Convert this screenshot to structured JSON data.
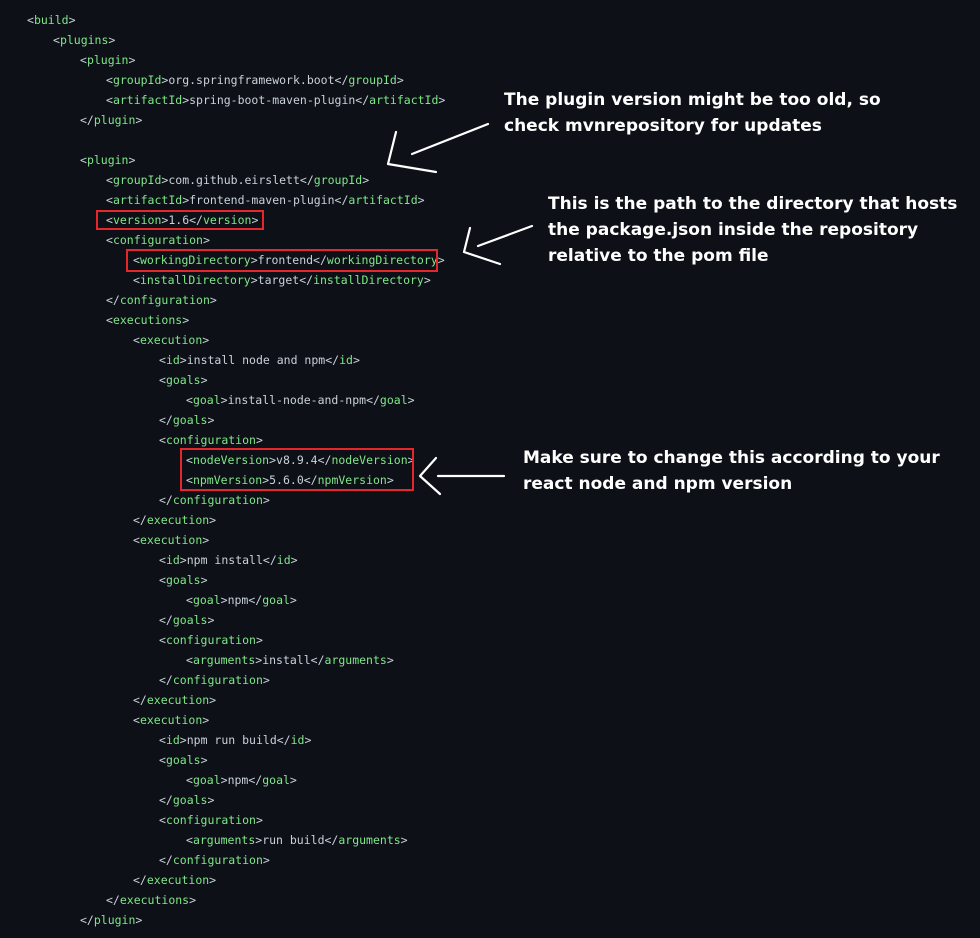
{
  "code_lines": [
    {
      "indent": 1,
      "tag": "build",
      "close": false
    },
    {
      "indent": 2,
      "tag": "plugins",
      "close": false
    },
    {
      "indent": 3,
      "tag": "plugin",
      "close": false
    },
    {
      "indent": 4,
      "tag": "groupId",
      "value": "org.springframework.boot"
    },
    {
      "indent": 4,
      "tag": "artifactId",
      "value": "spring-boot-maven-plugin"
    },
    {
      "indent": 3,
      "tag": "plugin",
      "close": true
    },
    {
      "blank": true
    },
    {
      "indent": 3,
      "tag": "plugin",
      "close": false
    },
    {
      "indent": 4,
      "tag": "groupId",
      "value": "com.github.eirslett"
    },
    {
      "indent": 4,
      "tag": "artifactId",
      "value": "frontend-maven-plugin"
    },
    {
      "indent": 4,
      "tag": "version",
      "value": "1.6"
    },
    {
      "indent": 4,
      "tag": "configuration",
      "close": false
    },
    {
      "indent": 5,
      "tag": "workingDirectory",
      "value": "frontend"
    },
    {
      "indent": 5,
      "tag": "installDirectory",
      "value": "target"
    },
    {
      "indent": 4,
      "tag": "configuration",
      "close": true
    },
    {
      "indent": 4,
      "tag": "executions",
      "close": false
    },
    {
      "indent": 5,
      "tag": "execution",
      "close": false
    },
    {
      "indent": 6,
      "tag": "id",
      "value": "install node and npm"
    },
    {
      "indent": 6,
      "tag": "goals",
      "close": false
    },
    {
      "indent": 7,
      "tag": "goal",
      "value": "install-node-and-npm"
    },
    {
      "indent": 6,
      "tag": "goals",
      "close": true
    },
    {
      "indent": 6,
      "tag": "configuration",
      "close": false
    },
    {
      "indent": 7,
      "tag": "nodeVersion",
      "value": "v8.9.4"
    },
    {
      "indent": 7,
      "tag": "npmVersion",
      "value": "5.6.0"
    },
    {
      "indent": 6,
      "tag": "configuration",
      "close": true
    },
    {
      "indent": 5,
      "tag": "execution",
      "close": true
    },
    {
      "indent": 5,
      "tag": "execution",
      "close": false
    },
    {
      "indent": 6,
      "tag": "id",
      "value": "npm install"
    },
    {
      "indent": 6,
      "tag": "goals",
      "close": false
    },
    {
      "indent": 7,
      "tag": "goal",
      "value": "npm"
    },
    {
      "indent": 6,
      "tag": "goals",
      "close": true
    },
    {
      "indent": 6,
      "tag": "configuration",
      "close": false
    },
    {
      "indent": 7,
      "tag": "arguments",
      "value": "install"
    },
    {
      "indent": 6,
      "tag": "configuration",
      "close": true
    },
    {
      "indent": 5,
      "tag": "execution",
      "close": true
    },
    {
      "indent": 5,
      "tag": "execution",
      "close": false
    },
    {
      "indent": 6,
      "tag": "id",
      "value": "npm run build"
    },
    {
      "indent": 6,
      "tag": "goals",
      "close": false
    },
    {
      "indent": 7,
      "tag": "goal",
      "value": "npm"
    },
    {
      "indent": 6,
      "tag": "goals",
      "close": true
    },
    {
      "indent": 6,
      "tag": "configuration",
      "close": false
    },
    {
      "indent": 7,
      "tag": "arguments",
      "value": "run build"
    },
    {
      "indent": 6,
      "tag": "configuration",
      "close": true
    },
    {
      "indent": 5,
      "tag": "execution",
      "close": true
    },
    {
      "indent": 4,
      "tag": "executions",
      "close": true
    },
    {
      "indent": 3,
      "tag": "plugin",
      "close": true
    }
  ],
  "annotations": {
    "version_note": "The plugin version might be too old, so check mvnrepository for updates",
    "directory_note": "This is the path to the directory that hosts the package.json inside the repository relative to the pom file",
    "node_npm_note": "Make sure to change this according to your react node and npm version"
  },
  "colors": {
    "background": "#0d1117",
    "tag": "#7ee787",
    "text": "#c9d1d9",
    "highlight_box": "#e5262b",
    "note_text": "#ffffff"
  }
}
